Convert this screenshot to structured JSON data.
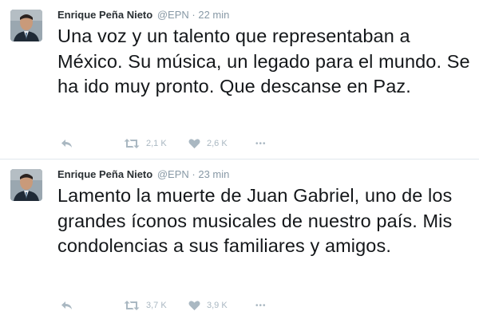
{
  "tweets": [
    {
      "fullname": "Enrique Peña Nieto",
      "handle": "@EPN",
      "separator": "·",
      "time": "22 min",
      "text": "Una voz y un talento que representaban a México. Su música, un legado para el mundo. Se ha ido muy pronto. Que descanse en Paz.",
      "retweets": "2,1 K",
      "likes": "2,6 K",
      "more": "•••"
    },
    {
      "fullname": "Enrique Peña Nieto",
      "handle": "@EPN",
      "separator": "·",
      "time": "23 min",
      "text": "Lamento la muerte de Juan Gabriel, uno de los grandes íconos musicales de nuestro país. Mis condolencias a sus familiares y amigos.",
      "retweets": "3,7 K",
      "likes": "3,9 K",
      "more": "•••"
    }
  ],
  "colors": {
    "name": "#292f33",
    "meta": "#8899a6",
    "action": "#aab8c2",
    "divider": "#e1e8ed"
  }
}
